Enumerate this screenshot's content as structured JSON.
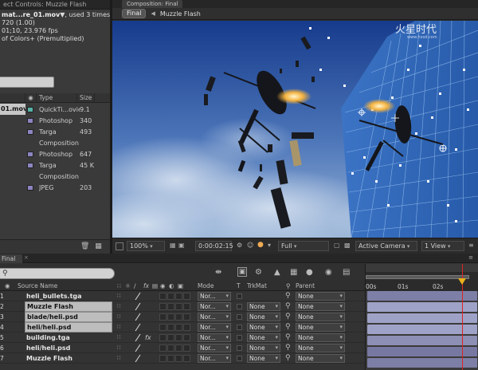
{
  "colors": {
    "accent_cti": "#dd2222",
    "cti_head": "#e8b21c",
    "sky_top": "#163b8c",
    "sky_bottom": "#9bb6d8",
    "building": "#3c74c5",
    "layer_bar": "#9fa2c7"
  },
  "project": {
    "tab_label": "ect Controls: Muzzle Flash",
    "info_title": "mat...re_01.mov",
    "info_used": ", used 3 times",
    "info_lines": [
      "720 (1.00)",
      "01;10, 23.976 fps",
      "of Colors+ (Premultiplied)"
    ],
    "columns": {
      "name": "",
      "label": "",
      "type": "Type",
      "size": "Size"
    },
    "items": [
      {
        "name": "01.mov",
        "swatch": "#57b3a6",
        "type": "QuickTi...ovie",
        "size": "9.1",
        "selected": true
      },
      {
        "name": "",
        "swatch": "#8c85c1",
        "type": "Photoshop",
        "size": "340"
      },
      {
        "name": "",
        "swatch": "#8c85c1",
        "type": "Targa",
        "size": "493"
      },
      {
        "name": "",
        "swatch": "",
        "type": "Composition",
        "size": ""
      },
      {
        "name": "",
        "swatch": "#8c85c1",
        "type": "Photoshop",
        "size": "647"
      },
      {
        "name": "",
        "swatch": "#8c85c1",
        "type": "Targa",
        "size": "45 K"
      },
      {
        "name": "",
        "swatch": "",
        "type": "Composition",
        "size": ""
      },
      {
        "name": "",
        "swatch": "#8c85c1",
        "type": "JPEG",
        "size": "203"
      }
    ]
  },
  "comp": {
    "tab_label": "Composition: Final",
    "crumb_active": "Final",
    "crumb_next": "Muzzle Flash",
    "watermark": "火星时代",
    "watermark_url": "www.hxsd.com",
    "toolbar": {
      "zoom": "100%",
      "timecode": "0:00:02:15",
      "resolution": "Full",
      "camera": "Active Camera",
      "view": "1 View"
    }
  },
  "timeline": {
    "tab_label": "Final",
    "columns": {
      "source": "Source Name",
      "mode": "Mode",
      "t": "T",
      "trkmat": "TrkMat",
      "parent": "Parent"
    },
    "ruler": [
      "00s",
      "01s",
      "02s"
    ],
    "layers": [
      {
        "num": "1",
        "name": "heli_bullets.tga",
        "boxed": false,
        "mode": "Nor...",
        "trkmat": "",
        "parent": "None",
        "fx": ""
      },
      {
        "num": "2",
        "name": "Muzzle Flash",
        "boxed": true,
        "mode": "Nor...",
        "trkmat": "None",
        "parent": "None",
        "fx": ""
      },
      {
        "num": "3",
        "name": "blade/heli.psd",
        "boxed": true,
        "mode": "Nor...",
        "trkmat": "None",
        "parent": "None",
        "fx": ""
      },
      {
        "num": "4",
        "name": "heli/heli.psd",
        "boxed": true,
        "mode": "Nor...",
        "trkmat": "None",
        "parent": "None",
        "fx": ""
      },
      {
        "num": "5",
        "name": "building.tga",
        "boxed": false,
        "mode": "Nor...",
        "trkmat": "None",
        "parent": "None",
        "fx": "fx"
      },
      {
        "num": "6",
        "name": "heli/heli.psd",
        "boxed": false,
        "mode": "Nor...",
        "trkmat": "None",
        "parent": "None",
        "fx": ""
      },
      {
        "num": "7",
        "name": "Muzzle Flash",
        "boxed": false,
        "mode": "Nor...",
        "trkmat": "None",
        "parent": "None",
        "fx": ""
      }
    ]
  }
}
